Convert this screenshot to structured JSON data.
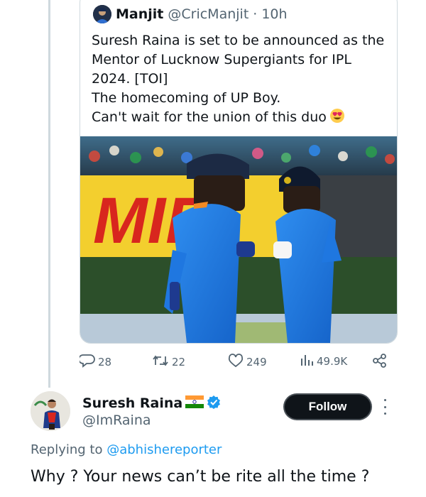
{
  "quoted_tweet": {
    "author_name": "Manjit",
    "author_handle": "@CricManjit",
    "separator": "·",
    "time": "10h",
    "text_lines": [
      "Suresh Raina is set to be announced as the",
      "Mentor of Lucknow Supergiants for IPL",
      "2024. [TOI]",
      "The homecoming of UP Boy.",
      "Can't wait for the union of this duo"
    ],
    "emoji_icon": "heart-eyes-emoji",
    "media_banner_text": "MIR"
  },
  "actions": {
    "replies": "28",
    "retweets": "22",
    "likes": "249",
    "views": "49.9K"
  },
  "reply": {
    "author_name": "Suresh Raina",
    "author_handle": "@ImRaina",
    "follow_label": "Follow",
    "replying_prefix": "Replying to",
    "replying_mention": "@abhishereporter",
    "text": "Why ? Your news can’t be rite all the time ?"
  },
  "colors": {
    "accent": "#1d9bf0",
    "muted": "#536471",
    "text": "#0f1419",
    "verified": "#1d9bf0"
  }
}
